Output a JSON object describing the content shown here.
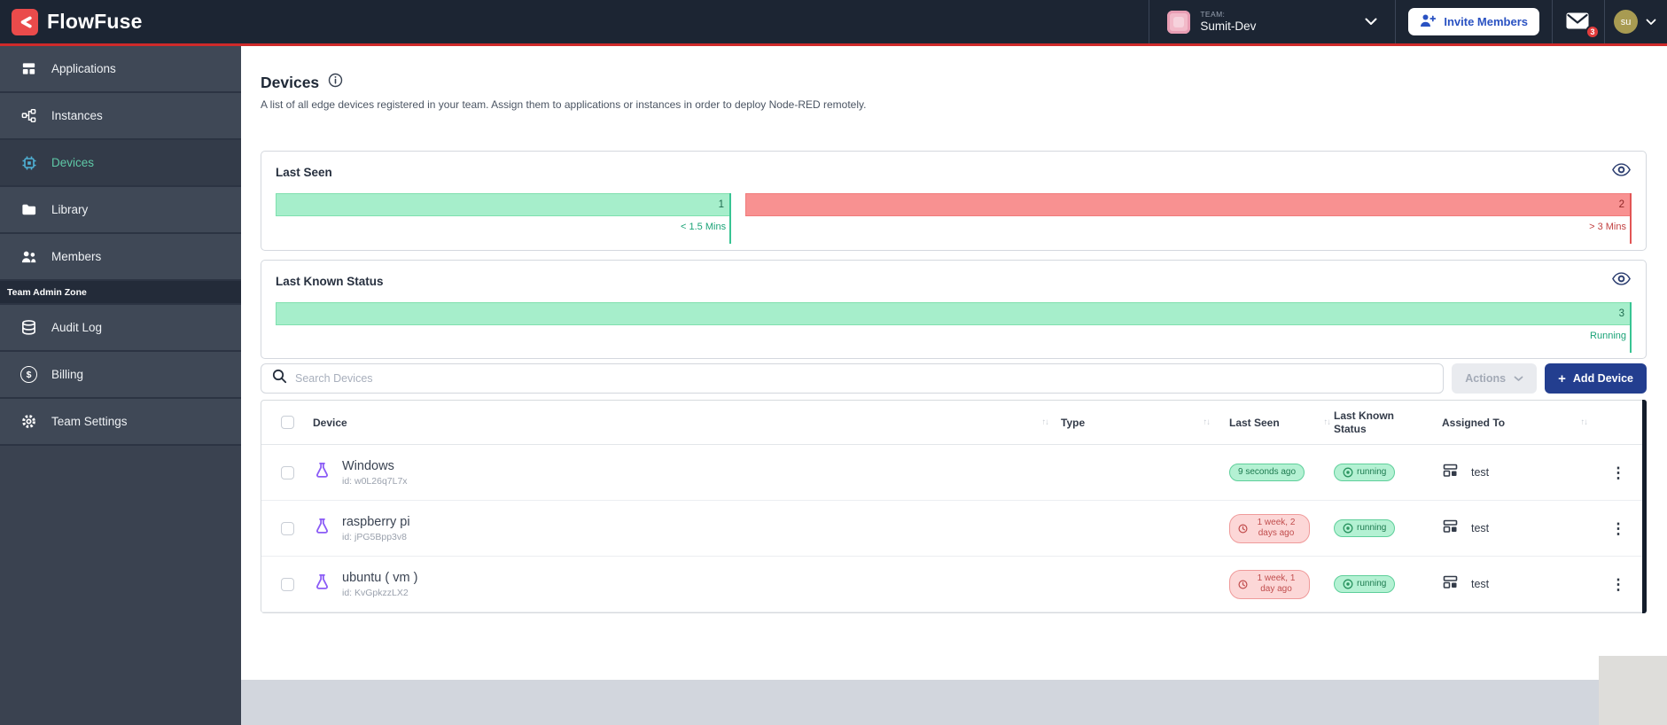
{
  "navbar": {
    "brand": "FlowFuse",
    "team_label": "TEAM:",
    "team_name": "Sumit-Dev",
    "invite_label": "Invite Members",
    "mail_badge": "3",
    "avatar": "su"
  },
  "sidebar": {
    "items": [
      {
        "label": "Applications"
      },
      {
        "label": "Instances"
      },
      {
        "label": "Devices"
      },
      {
        "label": "Library"
      },
      {
        "label": "Members"
      }
    ],
    "admin_header": "Team Admin Zone",
    "admin_items": [
      {
        "label": "Audit Log"
      },
      {
        "label": "Billing"
      },
      {
        "label": "Team Settings"
      }
    ]
  },
  "page": {
    "title": "Devices",
    "description": "A list of all edge devices registered in your team. Assign them to applications or instances in order to deploy Node-RED remotely."
  },
  "chart_data": [
    {
      "type": "bar",
      "title": "Last Seen",
      "orientation": "horizontal-stacked",
      "categories": [
        "< 1.5 Mins",
        "> 3 Mins"
      ],
      "values": [
        1,
        2
      ],
      "segment_colors": [
        "#a6eecb",
        "#f89191"
      ],
      "legend": "none"
    },
    {
      "type": "bar",
      "title": "Last Known Status",
      "orientation": "horizontal-stacked",
      "categories": [
        "Running"
      ],
      "values": [
        3
      ],
      "segment_colors": [
        "#a6eecb"
      ],
      "legend": "none"
    }
  ],
  "toolbar": {
    "search_placeholder": "Search Devices",
    "actions_label": "Actions",
    "add_plus": "+",
    "add_device_label": "Add Device"
  },
  "table": {
    "headers": [
      "Device",
      "Type",
      "Last Seen",
      "Last Known Status",
      "Assigned To"
    ],
    "rows": [
      {
        "name": "Windows",
        "device_id": "id: w0L26q7L7x",
        "last_seen": "9 seconds ago",
        "last_seen_state": "recent",
        "status": "running",
        "assigned_to": "test"
      },
      {
        "name": "raspberry pi",
        "device_id": "id: jPG5Bpp3v8",
        "last_seen": "1 week, 2 days ago",
        "last_seen_state": "stale",
        "status": "running",
        "assigned_to": "test"
      },
      {
        "name": "ubuntu ( vm )",
        "device_id": "id: KvGpkzzLX2",
        "last_seen": "1 week, 1 day ago",
        "last_seen_state": "stale",
        "status": "running",
        "assigned_to": "test"
      }
    ]
  },
  "icons": {
    "sort": "↑↓",
    "kebab": "⋮",
    "dollar": "$"
  },
  "colors": {
    "accent_red": "#cf2a2a",
    "logo_red": "#ea4b4b",
    "navbar_bg": "#1c2533",
    "sidebar_bg": "#3f4856",
    "active_nav_text": "#5fc9a7",
    "primary_button": "#233e8f",
    "chart_green": "#a6eecb",
    "chart_red": "#f89191",
    "badge_green_text": "#1d7a4f",
    "badge_red_text": "#c14e4e",
    "team_avatar_bg": "#f2bac9",
    "user_avatar_bg": "#a89b52"
  }
}
